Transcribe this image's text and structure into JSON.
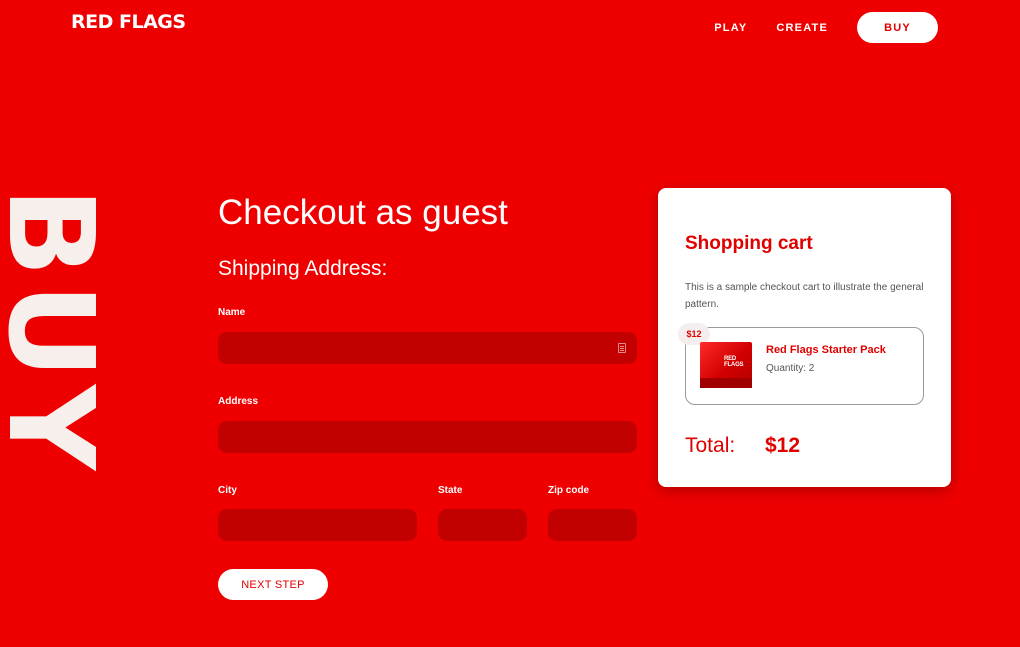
{
  "header": {
    "logo": "RED FLAGS",
    "nav": {
      "play": "PLAY",
      "create": "CREATE",
      "buy": "BUY"
    }
  },
  "background_word": "BUY",
  "form": {
    "title": "Checkout as guest",
    "subtitle": "Shipping Address:",
    "fields": {
      "name": {
        "label": "Name",
        "value": ""
      },
      "address": {
        "label": "Address",
        "value": ""
      },
      "city": {
        "label": "City",
        "value": ""
      },
      "state": {
        "label": "State",
        "value": ""
      },
      "zip": {
        "label": "Zip code",
        "value": ""
      }
    },
    "next_button": "NEXT STEP"
  },
  "cart": {
    "title": "Shopping cart",
    "description": "This is a sample checkout cart to illustrate the general pattern.",
    "items": [
      {
        "price": "$12",
        "image_label": "RED FLAGS",
        "name": "Red Flags Starter Pack",
        "quantity": "Quantity: 2"
      }
    ],
    "total_label": "Total:",
    "total_value": "$12"
  },
  "colors": {
    "brand_red": "#ee0000",
    "field_red": "#c20000",
    "accent_red": "#e00000",
    "white": "#ffffff"
  },
  "icons": {
    "name_field_icon": "contact-card-icon"
  }
}
